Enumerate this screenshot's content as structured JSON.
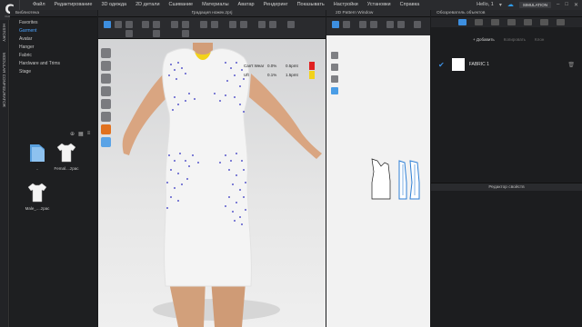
{
  "app": {
    "logo_letter": "C",
    "logo_sub": "CLO3D",
    "greeting": "Hello, 1",
    "simulation_label": "SIMULATION"
  },
  "menu": [
    "Файл",
    "Редактирование",
    "3D одежда",
    "2D детали",
    "Сшивание",
    "Материалы",
    "Аватар",
    "Рендеринг",
    "Показывать",
    "Настройки",
    "Установки",
    "Справка"
  ],
  "left_rail": [
    "HISTORY",
    "MODULAR CONFIGURATOR"
  ],
  "library": {
    "title": "Библиотека",
    "tree": [
      "Favorites",
      "Garment",
      "Avatar",
      "Hanger",
      "Fabric",
      "Hardware and Trims",
      "Stage"
    ],
    "selected": "Garment",
    "files": [
      {
        "label": ".."
      },
      {
        "label": "Femal....zpac"
      },
      {
        "label": "Male_....zpac"
      }
    ]
  },
  "view3d": {
    "title": "Градация ножек.zprj",
    "strain": [
      {
        "label": "Can't Wear",
        "pct": "0.0%",
        "val": "0.5pmt"
      },
      {
        "label": "Uft",
        "pct": "0.1%",
        "val": "1.5pmt"
      }
    ]
  },
  "view2d": {
    "title": "2D Pattern Window"
  },
  "object_browser": {
    "title": "Обозреватель объектов",
    "add_label": "Добавить",
    "apply_label": "Копировать",
    "clone_label": "Клон",
    "fabric_name": "FABRIC 1",
    "properties_title": "Редактор свойств"
  },
  "colors": {
    "accent": "#3d8fe0",
    "panel": "#1c1d1f",
    "strain_red": "#e02020",
    "strain_yellow": "#f2d21a"
  }
}
